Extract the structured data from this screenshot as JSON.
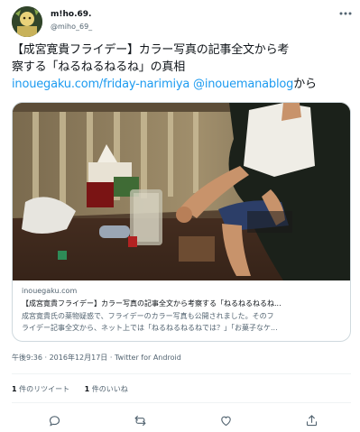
{
  "user": {
    "display_name": "m!ho.69.",
    "handle": "@miho_69_"
  },
  "tweet": {
    "line1": "【成宮寛貴フライデー】カラー写真の記事全文から考",
    "line2": "察する「ねるねるねるね」の真相",
    "link1": "inouegaku.com/friday-narimiya",
    "mention": "@inouemanablog",
    "suffix": "から"
  },
  "card": {
    "domain": "inouegaku.com",
    "title": "【成宮寛貴フライデー】カラー写真の記事全文から考察する「ねるねるねるね...",
    "desc_line1": "成宮寛貴氏の薬物疑惑で、フライデーのカラー写真も公開されました。そのフ",
    "desc_line2": "ライデー記事全文から、ネット上では「ねるねるねるねでは？」「お菓子なケ..."
  },
  "timestamp": "午後9:36 · 2016年12月17日 · Twitter for Android",
  "stats": {
    "retweets_count": "1",
    "retweets_label": "件のリツイート",
    "likes_count": "1",
    "likes_label": "件のいいね"
  },
  "icons": {
    "more": "more-icon",
    "reply": "reply-icon",
    "retweet": "retweet-icon",
    "like": "heart-icon",
    "share": "share-icon"
  },
  "colors": {
    "link": "#1d9bf0",
    "secondary_text": "#536471",
    "border": "#cfd9de"
  }
}
